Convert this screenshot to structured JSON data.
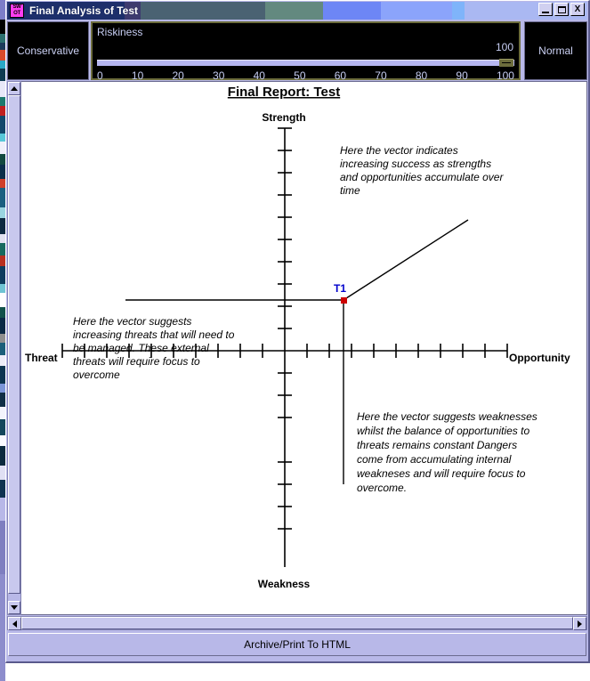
{
  "window": {
    "title": "Final Analysis of Test",
    "icon_name": "swot-icon",
    "icon_line1": "SW",
    "icon_line2": "OT",
    "minimize_label": "_",
    "maximize_label": "□",
    "close_label": "X"
  },
  "toolbar": {
    "left_label": "Conservative",
    "right_label": "Normal",
    "slider_title": "Riskiness",
    "slider_value": "100",
    "ticks": [
      "0",
      "10",
      "20",
      "30",
      "40",
      "50",
      "60",
      "70",
      "80",
      "90",
      "100"
    ]
  },
  "status": {
    "text": "Archive/Print To HTML"
  },
  "scrollbars": {
    "up_arrow": "▲",
    "down_arrow": "▼",
    "left_arrow": "◀",
    "right_arrow": "▶"
  },
  "chart_data": {
    "type": "scatter",
    "title": "Final Report: Test",
    "axis_labels": {
      "top": "Strength",
      "bottom": "Weakness",
      "left": "Threat",
      "right": "Opportunity"
    },
    "xlabel": "Threat — Opportunity",
    "ylabel": "Weakness — Strength",
    "xlim": [
      -10,
      10
    ],
    "ylim": [
      -10,
      10
    ],
    "grid": false,
    "legend": "none",
    "points": [
      {
        "name": "T1",
        "x": 1.4,
        "y": 1.4,
        "color": "#cc0000",
        "label_color": "#0000cc"
      }
    ],
    "vectors": [
      {
        "name": "success-vector",
        "from": [
          1.4,
          1.4
        ],
        "to": [
          7.0,
          5.0
        ],
        "color": "#000000"
      },
      {
        "name": "threat-vector",
        "from": [
          1.4,
          1.4
        ],
        "to": [
          -8.1,
          1.4
        ],
        "color": "#000000"
      },
      {
        "name": "weakness-vector",
        "from": [
          1.4,
          1.4
        ],
        "to": [
          1.4,
          -6.0
        ],
        "color": "#000000"
      }
    ],
    "annotations": [
      {
        "name": "success-note",
        "lines": [
          "Here the vector indicates",
          "increasing success as strengths",
          "and opportunities accumulate over",
          "time"
        ]
      },
      {
        "name": "threat-note",
        "lines": [
          "Here the vector suggests",
          "increasing threats that will need to",
          "be managed. These external",
          "threats will require focus to",
          "overcome"
        ]
      },
      {
        "name": "weakness-note",
        "lines": [
          "Here the vector suggests weaknesses",
          "whilst the balance of opportunities to",
          "threats remains constant  Dangers",
          "come from accumulating internal",
          "weakneses and will require focus to",
          "overcome."
        ]
      }
    ]
  },
  "colors": {
    "title_bar_start": "#1d2f6b",
    "title_bar_end": "#aab8f2",
    "window_chrome": "#b8b8e8",
    "panel_bg": "#000000",
    "panel_text": "#c6cdf2",
    "marker": "#cc0000",
    "marker_label": "#0000cc"
  }
}
